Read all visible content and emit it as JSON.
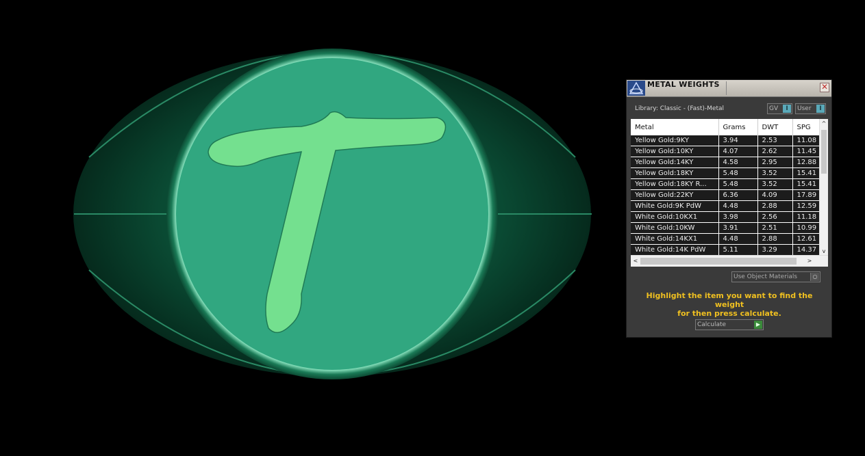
{
  "panel": {
    "title": "METAL WEIGHTS",
    "close_glyph": "✕",
    "library_label": "Library: Classic - (Fast)-Metal",
    "toggles": [
      {
        "label": "GV",
        "knob": "I"
      },
      {
        "label": "User",
        "knob": "I"
      }
    ],
    "table": {
      "columns": [
        "Metal",
        "Grams",
        "DWT",
        "SPG"
      ],
      "rows": [
        [
          "Yellow Gold:9KY",
          "3.94",
          "2.53",
          "11.08"
        ],
        [
          "Yellow Gold:10KY",
          "4.07",
          "2.62",
          "11.45"
        ],
        [
          "Yellow Gold:14KY",
          "4.58",
          "2.95",
          "12.88"
        ],
        [
          "Yellow Gold:18KY",
          "5.48",
          "3.52",
          "15.41"
        ],
        [
          "Yellow Gold:18KY R...",
          "5.48",
          "3.52",
          "15.41"
        ],
        [
          "Yellow Gold:22KY",
          "6.36",
          "4.09",
          "17.89"
        ],
        [
          "White Gold:9K PdW",
          "4.48",
          "2.88",
          "12.59"
        ],
        [
          "White Gold:10KX1",
          "3.98",
          "2.56",
          "11.18"
        ],
        [
          "White Gold:10KW",
          "3.91",
          "2.51",
          "10.99"
        ],
        [
          "White Gold:14KX1",
          "4.48",
          "2.88",
          "12.61"
        ],
        [
          "White Gold:14K PdW",
          "5.11",
          "3.29",
          "14.37"
        ]
      ]
    },
    "scroll": {
      "up": "^",
      "down": "v",
      "left": "<",
      "right": ">"
    },
    "use_object_materials": {
      "label": "Use Object Materials",
      "knob": "○"
    },
    "instructions": [
      "Highlight the item you want to find the weight",
      "for then press calculate."
    ],
    "calculate": {
      "label": "Calculate",
      "knob": "▶"
    }
  },
  "viewport": {
    "monogram": "T",
    "colors": {
      "background": "#000000",
      "ring": "#2fa37c",
      "monogram": "#74e08f",
      "accent": "#f0c020"
    }
  }
}
